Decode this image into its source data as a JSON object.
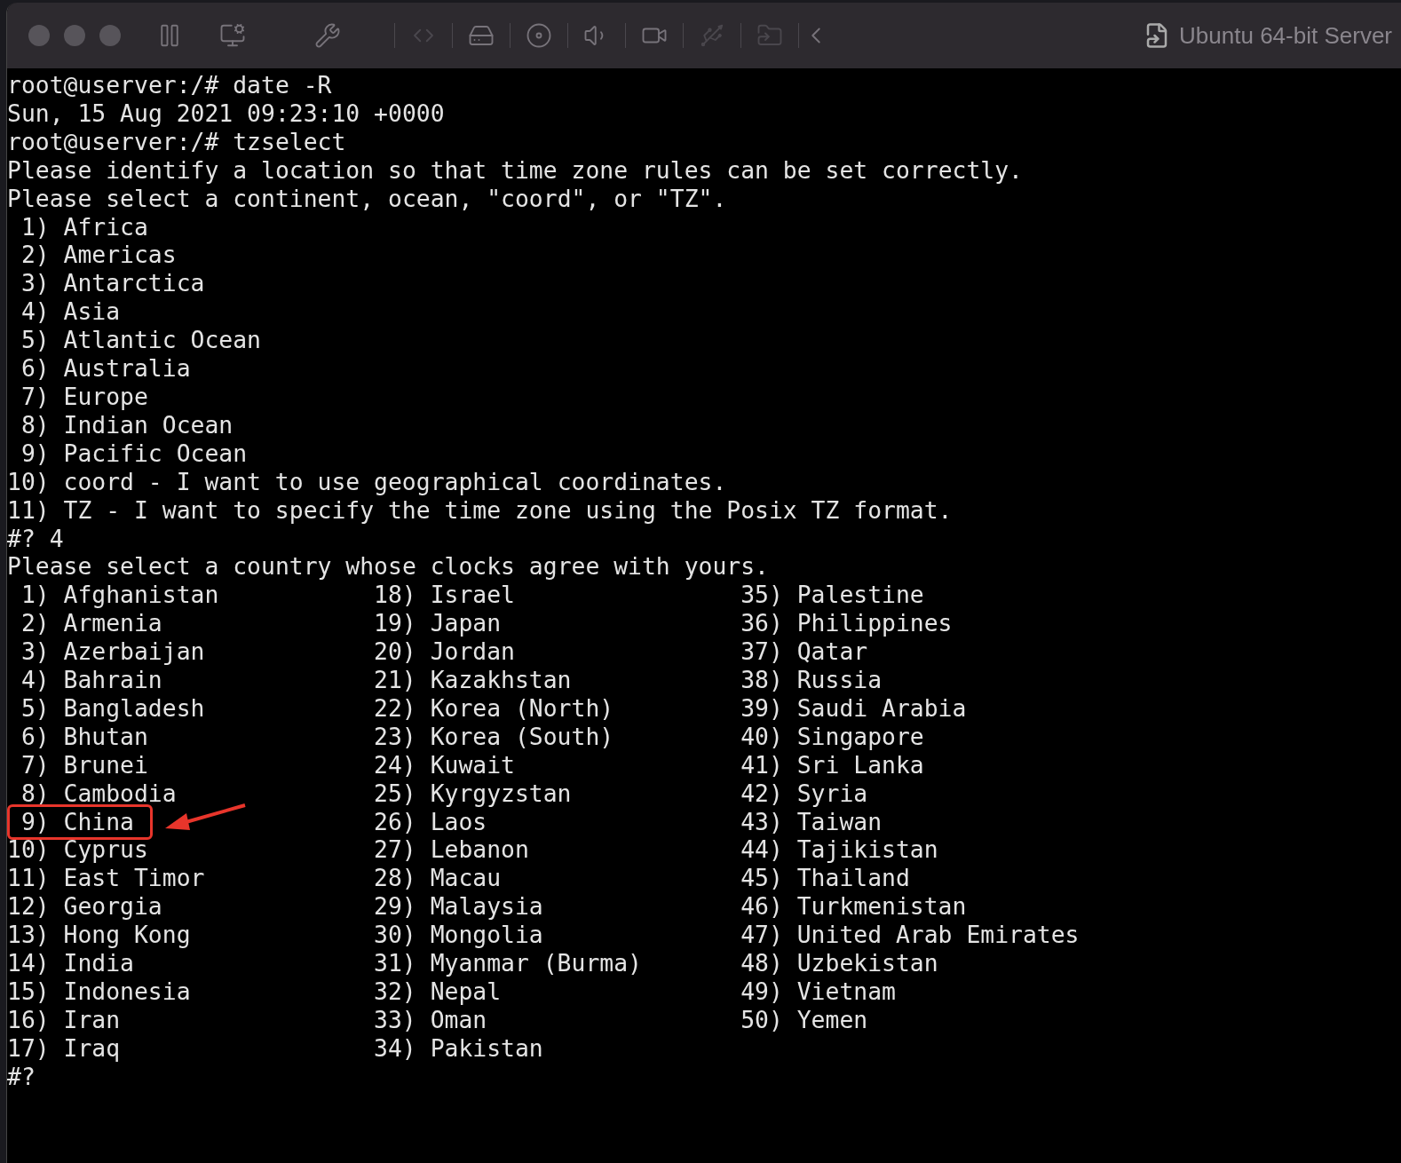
{
  "window": {
    "title": "Ubuntu 64-bit Server"
  },
  "terminal": {
    "blocks": [
      {
        "kind": "text",
        "lines": [
          "root@userver:/# date -R",
          "Sun, 15 Aug 2021 09:23:10 +0000",
          "root@userver:/# tzselect",
          "Please identify a location so that time zone rules can be set correctly.",
          "Please select a continent, ocean, \"coord\", or \"TZ\"."
        ]
      },
      {
        "kind": "menu",
        "items": [
          {
            "number": "1)",
            "name": "Africa"
          },
          {
            "number": "2)",
            "name": "Americas"
          },
          {
            "number": "3)",
            "name": "Antarctica"
          },
          {
            "number": "4)",
            "name": "Asia"
          },
          {
            "number": "5)",
            "name": "Atlantic Ocean"
          },
          {
            "number": "6)",
            "name": "Australia"
          },
          {
            "number": "7)",
            "name": "Europe"
          },
          {
            "number": "8)",
            "name": "Indian Ocean"
          },
          {
            "number": "9)",
            "name": "Pacific Ocean"
          },
          {
            "number": "10)",
            "name": "coord - I want to use geographical coordinates."
          },
          {
            "number": "11)",
            "name": "TZ - I want to specify the time zone using the Posix TZ format."
          }
        ]
      },
      {
        "kind": "text",
        "lines": [
          "#? 4",
          "Please select a country whose clocks agree with yours."
        ]
      },
      {
        "kind": "columns",
        "items": [
          {
            "number": "1)",
            "name": "Afghanistan",
            "highlighted": false
          },
          {
            "number": "2)",
            "name": "Armenia",
            "highlighted": false
          },
          {
            "number": "3)",
            "name": "Azerbaijan",
            "highlighted": false
          },
          {
            "number": "4)",
            "name": "Bahrain",
            "highlighted": false
          },
          {
            "number": "5)",
            "name": "Bangladesh",
            "highlighted": false
          },
          {
            "number": "6)",
            "name": "Bhutan",
            "highlighted": false
          },
          {
            "number": "7)",
            "name": "Brunei",
            "highlighted": false
          },
          {
            "number": "8)",
            "name": "Cambodia",
            "highlighted": false
          },
          {
            "number": "9)",
            "name": "China",
            "highlighted": true
          },
          {
            "number": "10)",
            "name": "Cyprus",
            "highlighted": false
          },
          {
            "number": "11)",
            "name": "East Timor",
            "highlighted": false
          },
          {
            "number": "12)",
            "name": "Georgia",
            "highlighted": false
          },
          {
            "number": "13)",
            "name": "Hong Kong",
            "highlighted": false
          },
          {
            "number": "14)",
            "name": "India",
            "highlighted": false
          },
          {
            "number": "15)",
            "name": "Indonesia",
            "highlighted": false
          },
          {
            "number": "16)",
            "name": "Iran",
            "highlighted": false
          },
          {
            "number": "17)",
            "name": "Iraq",
            "highlighted": false
          },
          {
            "number": "18)",
            "name": "Israel",
            "highlighted": false
          },
          {
            "number": "19)",
            "name": "Japan",
            "highlighted": false
          },
          {
            "number": "20)",
            "name": "Jordan",
            "highlighted": false
          },
          {
            "number": "21)",
            "name": "Kazakhstan",
            "highlighted": false
          },
          {
            "number": "22)",
            "name": "Korea (North)",
            "highlighted": false
          },
          {
            "number": "23)",
            "name": "Korea (South)",
            "highlighted": false
          },
          {
            "number": "24)",
            "name": "Kuwait",
            "highlighted": false
          },
          {
            "number": "25)",
            "name": "Kyrgyzstan",
            "highlighted": false
          },
          {
            "number": "26)",
            "name": "Laos",
            "highlighted": false
          },
          {
            "number": "27)",
            "name": "Lebanon",
            "highlighted": false
          },
          {
            "number": "28)",
            "name": "Macau",
            "highlighted": false
          },
          {
            "number": "29)",
            "name": "Malaysia",
            "highlighted": false
          },
          {
            "number": "30)",
            "name": "Mongolia",
            "highlighted": false
          },
          {
            "number": "31)",
            "name": "Myanmar (Burma)",
            "highlighted": false
          },
          {
            "number": "32)",
            "name": "Nepal",
            "highlighted": false
          },
          {
            "number": "33)",
            "name": "Oman",
            "highlighted": false
          },
          {
            "number": "34)",
            "name": "Pakistan",
            "highlighted": false
          },
          {
            "number": "35)",
            "name": "Palestine",
            "highlighted": false
          },
          {
            "number": "36)",
            "name": "Philippines",
            "highlighted": false
          },
          {
            "number": "37)",
            "name": "Qatar",
            "highlighted": false
          },
          {
            "number": "38)",
            "name": "Russia",
            "highlighted": false
          },
          {
            "number": "39)",
            "name": "Saudi Arabia",
            "highlighted": false
          },
          {
            "number": "40)",
            "name": "Singapore",
            "highlighted": false
          },
          {
            "number": "41)",
            "name": "Sri Lanka",
            "highlighted": false
          },
          {
            "number": "42)",
            "name": "Syria",
            "highlighted": false
          },
          {
            "number": "43)",
            "name": "Taiwan",
            "highlighted": false
          },
          {
            "number": "44)",
            "name": "Tajikistan",
            "highlighted": false
          },
          {
            "number": "45)",
            "name": "Thailand",
            "highlighted": false
          },
          {
            "number": "46)",
            "name": "Turkmenistan",
            "highlighted": false
          },
          {
            "number": "47)",
            "name": "United Arab Emirates",
            "highlighted": false
          },
          {
            "number": "48)",
            "name": "Uzbekistan",
            "highlighted": false
          },
          {
            "number": "49)",
            "name": "Vietnam",
            "highlighted": false
          },
          {
            "number": "50)",
            "name": "Yemen",
            "highlighted": false
          }
        ]
      },
      {
        "kind": "text",
        "lines": [
          "#?"
        ]
      }
    ]
  }
}
